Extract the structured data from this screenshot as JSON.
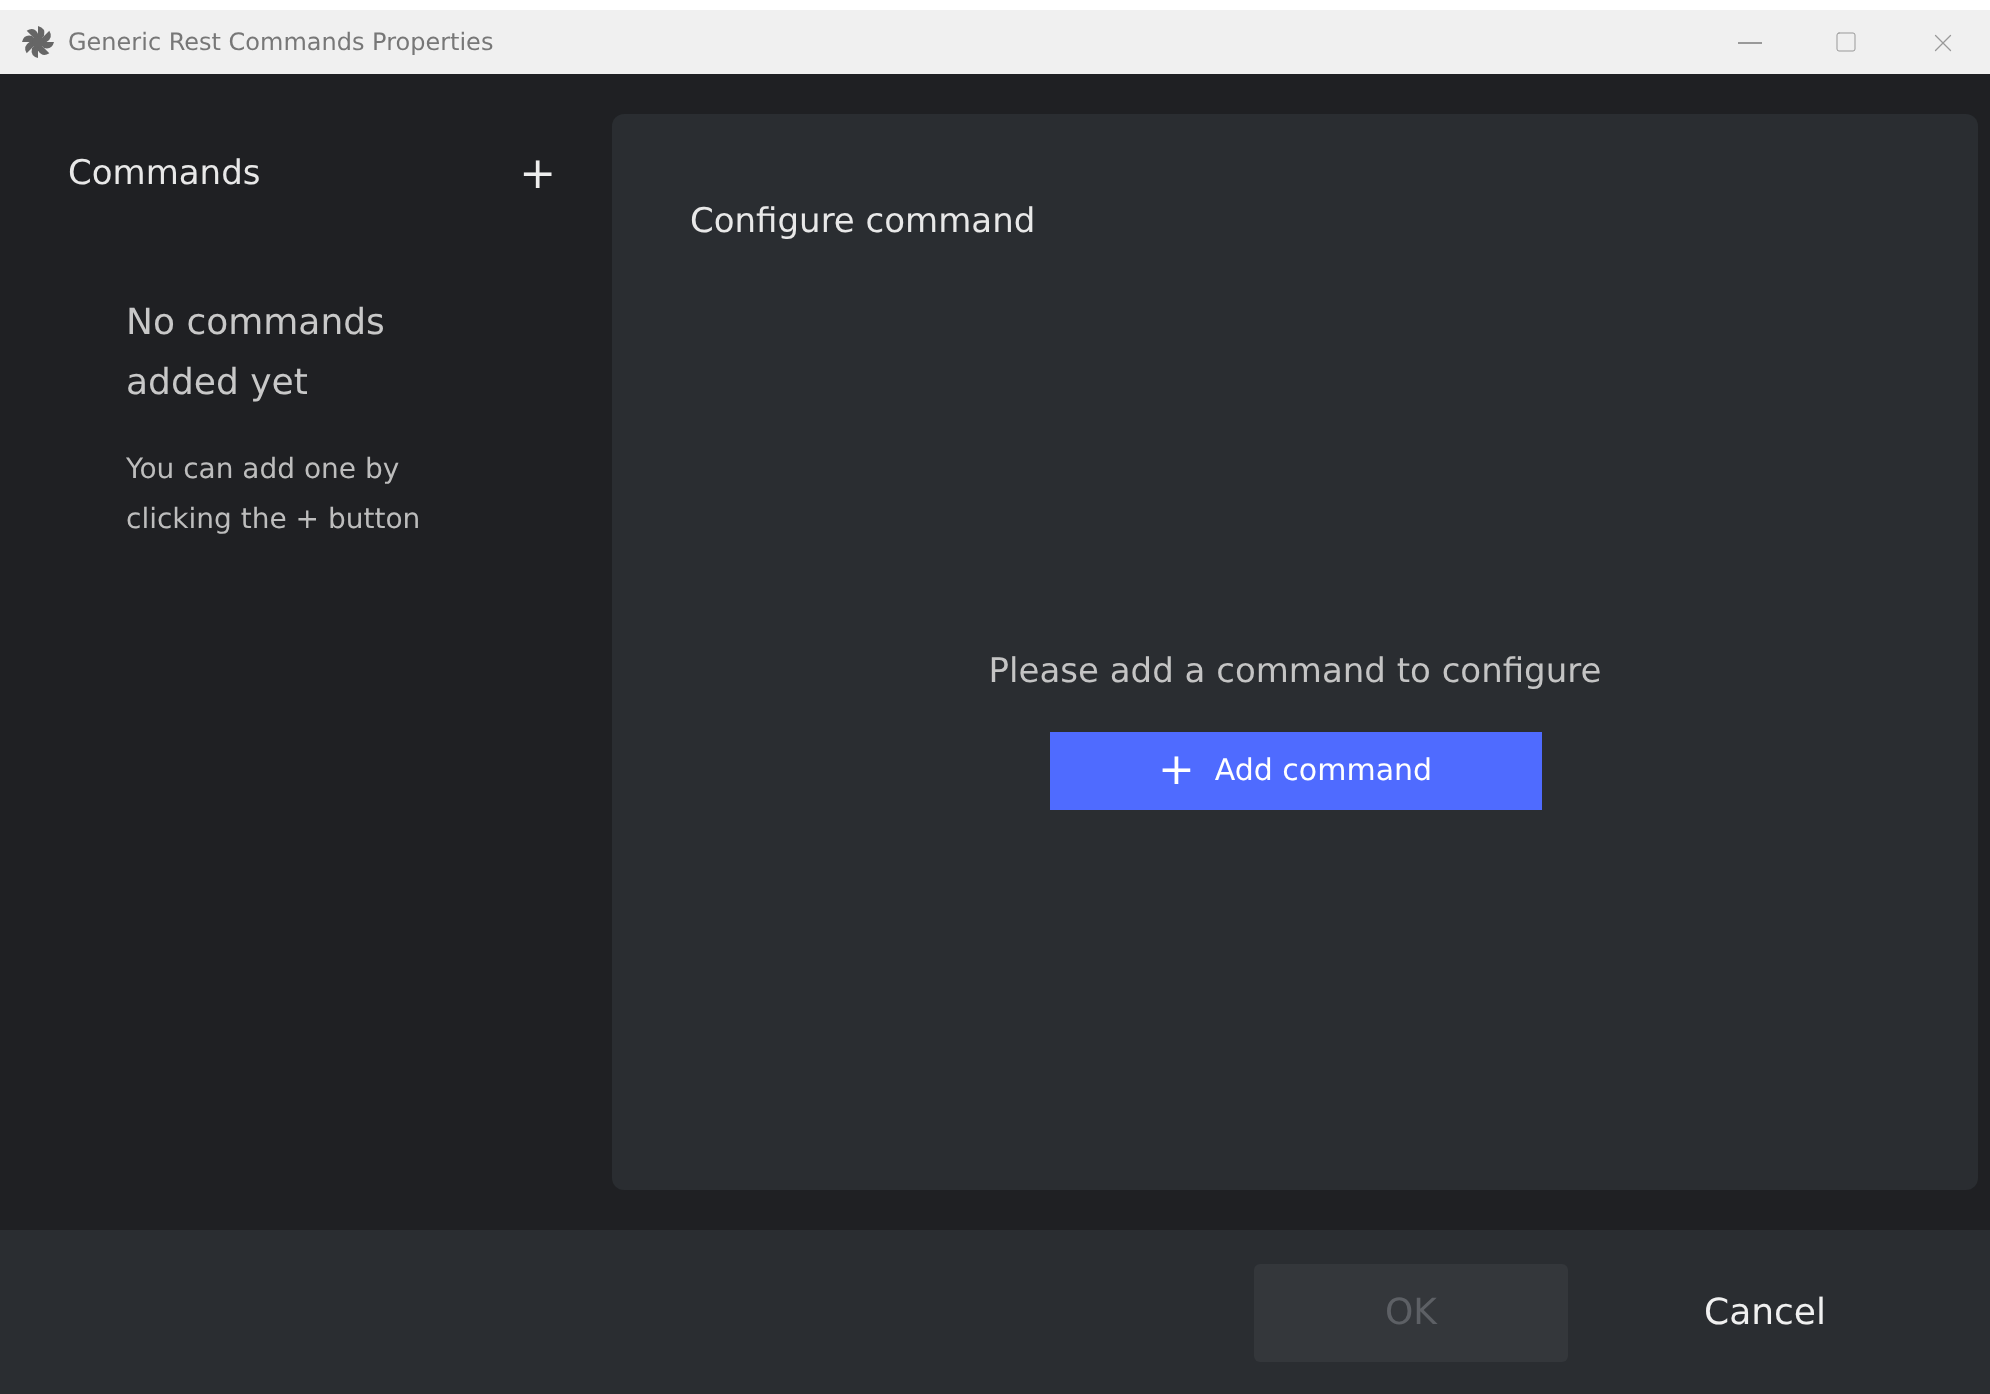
{
  "window": {
    "title": "Generic Rest Commands Properties"
  },
  "sidebar": {
    "title": "Commands",
    "add_button": "+",
    "empty_title": "No commands added yet",
    "empty_hint": "You can add one by clicking the + button"
  },
  "main": {
    "title": "Configure command",
    "empty_message": "Please add a command to configure",
    "add_button": {
      "icon": "+",
      "label": "Add command"
    }
  },
  "footer": {
    "buttons": [
      {
        "label": "OK",
        "disabled": true
      },
      {
        "label": "Cancel",
        "disabled": false
      }
    ]
  }
}
